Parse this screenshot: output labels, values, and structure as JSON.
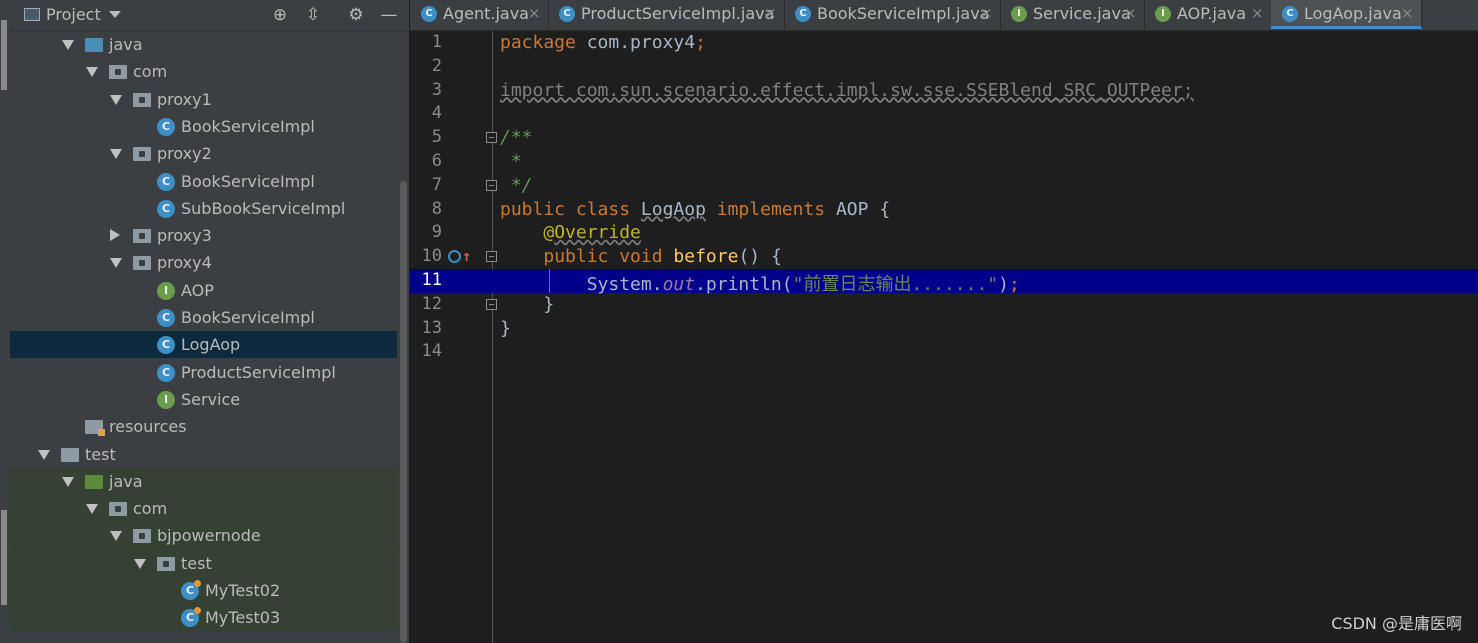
{
  "project_panel": {
    "title": "Project",
    "buttons": [
      "locate-icon",
      "collapse-icon",
      "settings-icon",
      "hide-icon"
    ]
  },
  "tree": [
    {
      "label": "java",
      "type": "folder-blue",
      "arrow": "down",
      "indent": 0
    },
    {
      "label": "com",
      "type": "package",
      "arrow": "down",
      "indent": 1
    },
    {
      "label": "proxy1",
      "type": "package",
      "arrow": "down",
      "indent": 2
    },
    {
      "label": "BookServiceImpl",
      "type": "class",
      "arrow": "",
      "indent": 3
    },
    {
      "label": "proxy2",
      "type": "package",
      "arrow": "down",
      "indent": 2
    },
    {
      "label": "BookServiceImpl",
      "type": "class",
      "arrow": "",
      "indent": 3
    },
    {
      "label": "SubBookServiceImpl",
      "type": "class",
      "arrow": "",
      "indent": 3
    },
    {
      "label": "proxy3",
      "type": "package",
      "arrow": "right",
      "indent": 2
    },
    {
      "label": "proxy4",
      "type": "package",
      "arrow": "down",
      "indent": 2
    },
    {
      "label": "AOP",
      "type": "interface",
      "arrow": "",
      "indent": 3
    },
    {
      "label": "BookServiceImpl",
      "type": "class",
      "arrow": "",
      "indent": 3
    },
    {
      "label": "LogAop",
      "type": "class",
      "arrow": "",
      "indent": 3,
      "selected": true
    },
    {
      "label": "ProductServiceImpl",
      "type": "class",
      "arrow": "",
      "indent": 3
    },
    {
      "label": "Service",
      "type": "interface",
      "arrow": "",
      "indent": 3
    },
    {
      "label": "resources",
      "type": "folder-res",
      "arrow": "",
      "indent": 0
    },
    {
      "label": "test",
      "type": "folder-gray",
      "arrow": "down",
      "indent": -1
    },
    {
      "label": "java",
      "type": "folder-green",
      "arrow": "down",
      "indent": 0,
      "test": true
    },
    {
      "label": "com",
      "type": "package",
      "arrow": "down",
      "indent": 1,
      "test": true
    },
    {
      "label": "bjpowernode",
      "type": "package",
      "arrow": "down",
      "indent": 2,
      "test": true
    },
    {
      "label": "test",
      "type": "package",
      "arrow": "down",
      "indent": 3,
      "test": true
    },
    {
      "label": "MyTest02",
      "type": "test-class",
      "arrow": "",
      "indent": 4,
      "test": true
    },
    {
      "label": "MyTest03",
      "type": "test-class",
      "arrow": "",
      "indent": 4,
      "test": true
    }
  ],
  "tabs": [
    {
      "name": "Agent.java",
      "icon": "C",
      "kind": "c"
    },
    {
      "name": "ProductServiceImpl.java",
      "icon": "C",
      "kind": "c"
    },
    {
      "name": "BookServiceImpl.java",
      "icon": "C",
      "kind": "c"
    },
    {
      "name": "Service.java",
      "icon": "I",
      "kind": "i"
    },
    {
      "name": "AOP.java",
      "icon": "I",
      "kind": "i"
    },
    {
      "name": "LogAop.java",
      "icon": "C",
      "kind": "c",
      "active": true
    }
  ],
  "tab_close_glyph": "×",
  "editor": {
    "current_line": 11,
    "lines": [
      {
        "n": "1",
        "tokens": [
          [
            "kw",
            "package "
          ],
          [
            "",
            "com.proxy4"
          ],
          [
            "kw",
            ";"
          ]
        ]
      },
      {
        "n": "2",
        "tokens": []
      },
      {
        "n": "3",
        "tokens": [
          [
            "unused",
            "import com.sun.scenario.effect.impl.sw.sse.SSEBlend_SRC_OUTPeer;"
          ]
        ]
      },
      {
        "n": "4",
        "tokens": []
      },
      {
        "n": "5",
        "tokens": [
          [
            "cm",
            "/**"
          ]
        ],
        "fold": true
      },
      {
        "n": "6",
        "tokens": [
          [
            "cm",
            " *"
          ]
        ]
      },
      {
        "n": "7",
        "tokens": [
          [
            "cm",
            " */"
          ]
        ],
        "fold": true
      },
      {
        "n": "8",
        "tokens": [
          [
            "kw",
            "public class "
          ],
          [
            "squig",
            "LogAop"
          ],
          [
            "kw",
            " implements "
          ],
          [
            "",
            "AOP {"
          ]
        ]
      },
      {
        "n": "9",
        "tokens": [
          [
            "",
            "    "
          ],
          [
            "an",
            "@"
          ],
          [
            "an squig",
            "Override"
          ]
        ]
      },
      {
        "n": "10",
        "tokens": [
          [
            "",
            "    "
          ],
          [
            "kw",
            "public void "
          ],
          [
            "fn",
            "before"
          ],
          [
            "",
            "() {"
          ]
        ],
        "fold": true,
        "impl": true
      },
      {
        "n": "11",
        "tokens": [
          [
            "",
            "        System."
          ],
          [
            "fld",
            "out"
          ],
          [
            "",
            ".println("
          ],
          [
            "str",
            "\"前置日志输出.......\""
          ],
          [
            "",
            ")"
          ],
          [
            "kw",
            ";"
          ]
        ],
        "guide": true
      },
      {
        "n": "12",
        "tokens": [
          [
            "",
            "    }"
          ]
        ],
        "fold": true
      },
      {
        "n": "13",
        "tokens": [
          [
            "",
            "}"
          ]
        ]
      },
      {
        "n": "14",
        "tokens": []
      }
    ]
  },
  "watermark": "CSDN @是庸医啊",
  "colors": {
    "keyword": "#cc7832",
    "string": "#6a8759",
    "comment": "#629755",
    "annotation": "#bbb529",
    "method": "#ffc66d",
    "current_line": "#00008b",
    "selection": "#0d293e",
    "test_tint": "#354133"
  }
}
